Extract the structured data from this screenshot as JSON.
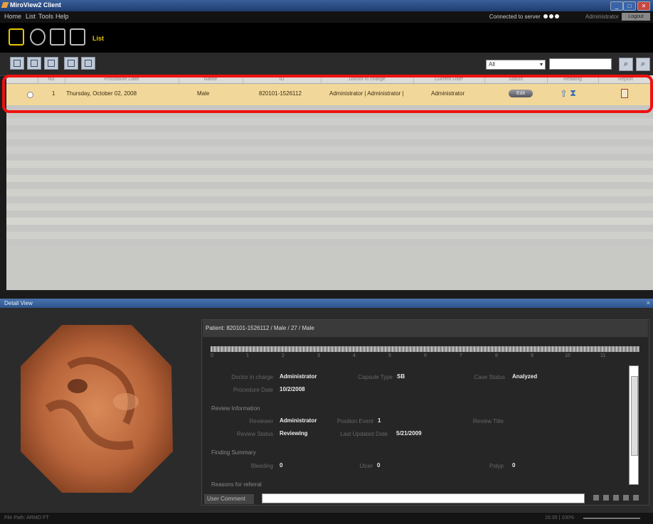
{
  "window": {
    "title": "MiroView2 Client",
    "min": "_",
    "max": "□",
    "close": "✕"
  },
  "menu": [
    "Home",
    "List",
    "Tools",
    "Help"
  ],
  "connection": {
    "text": "Connected to server",
    "user": "Administrator",
    "logout": "Logout"
  },
  "mode": {
    "label": "List"
  },
  "toolbar": {
    "filter_value": "All",
    "filter_arrow": "▾",
    "search_icon": "⌕",
    "advanced_icon": "⌕"
  },
  "table": {
    "columns": [
      "",
      "No",
      "Procedure Date",
      "Name",
      "ID",
      "Doctor in charge",
      "Current User",
      "Status",
      "Reading",
      "Report"
    ],
    "rows": [
      {
        "no": "1",
        "date": "Thursday, October 02, 2008",
        "name": "Male",
        "id": "820101-1526112",
        "doctor": "Administrator | Administrator |",
        "current_user": "Administrator",
        "status": "Edit"
      }
    ]
  },
  "detail": {
    "title": "Detail View",
    "patient": "Patient: 820101-1526112 / Male / 27 / Male",
    "ticks": [
      "0",
      "1",
      "2",
      "3",
      "4",
      "5",
      "6",
      "7",
      "8",
      "9",
      "10",
      "11"
    ],
    "fields": {
      "doctor_label": "Doctor in charge",
      "doctor_value": "Administrator",
      "capsule_label": "Capsule Type",
      "capsule_value": "SB",
      "case_status_label": "Case Status",
      "case_status_value": "Analyzed",
      "procedure_label": "Procedure Date",
      "procedure_value": "10/2/2008",
      "review_section": "Review Information",
      "reviewer_label": "Reviewer",
      "reviewer_value": "Administrator",
      "position_label": "Position Event",
      "position_value": "1",
      "review_title_label": "Review Title",
      "review_status_label": "Review Status",
      "review_status_value": "Reviewing",
      "last_updated_label": "Last Updated Date",
      "last_updated_value": "5/21/2009",
      "finding_section": "Finding Summary",
      "bleeding_label": "Bleeding",
      "bleeding_value": "0",
      "ulcer_label": "Ulcer",
      "ulcer_value": "0",
      "polyp_label": "Polyp",
      "polyp_value": "0",
      "referral_label": "Reasons for referral"
    },
    "comment_label": "User Comment"
  },
  "status": {
    "left": "File Path: ARMO FT",
    "zoom": "16:35  |  100%"
  }
}
